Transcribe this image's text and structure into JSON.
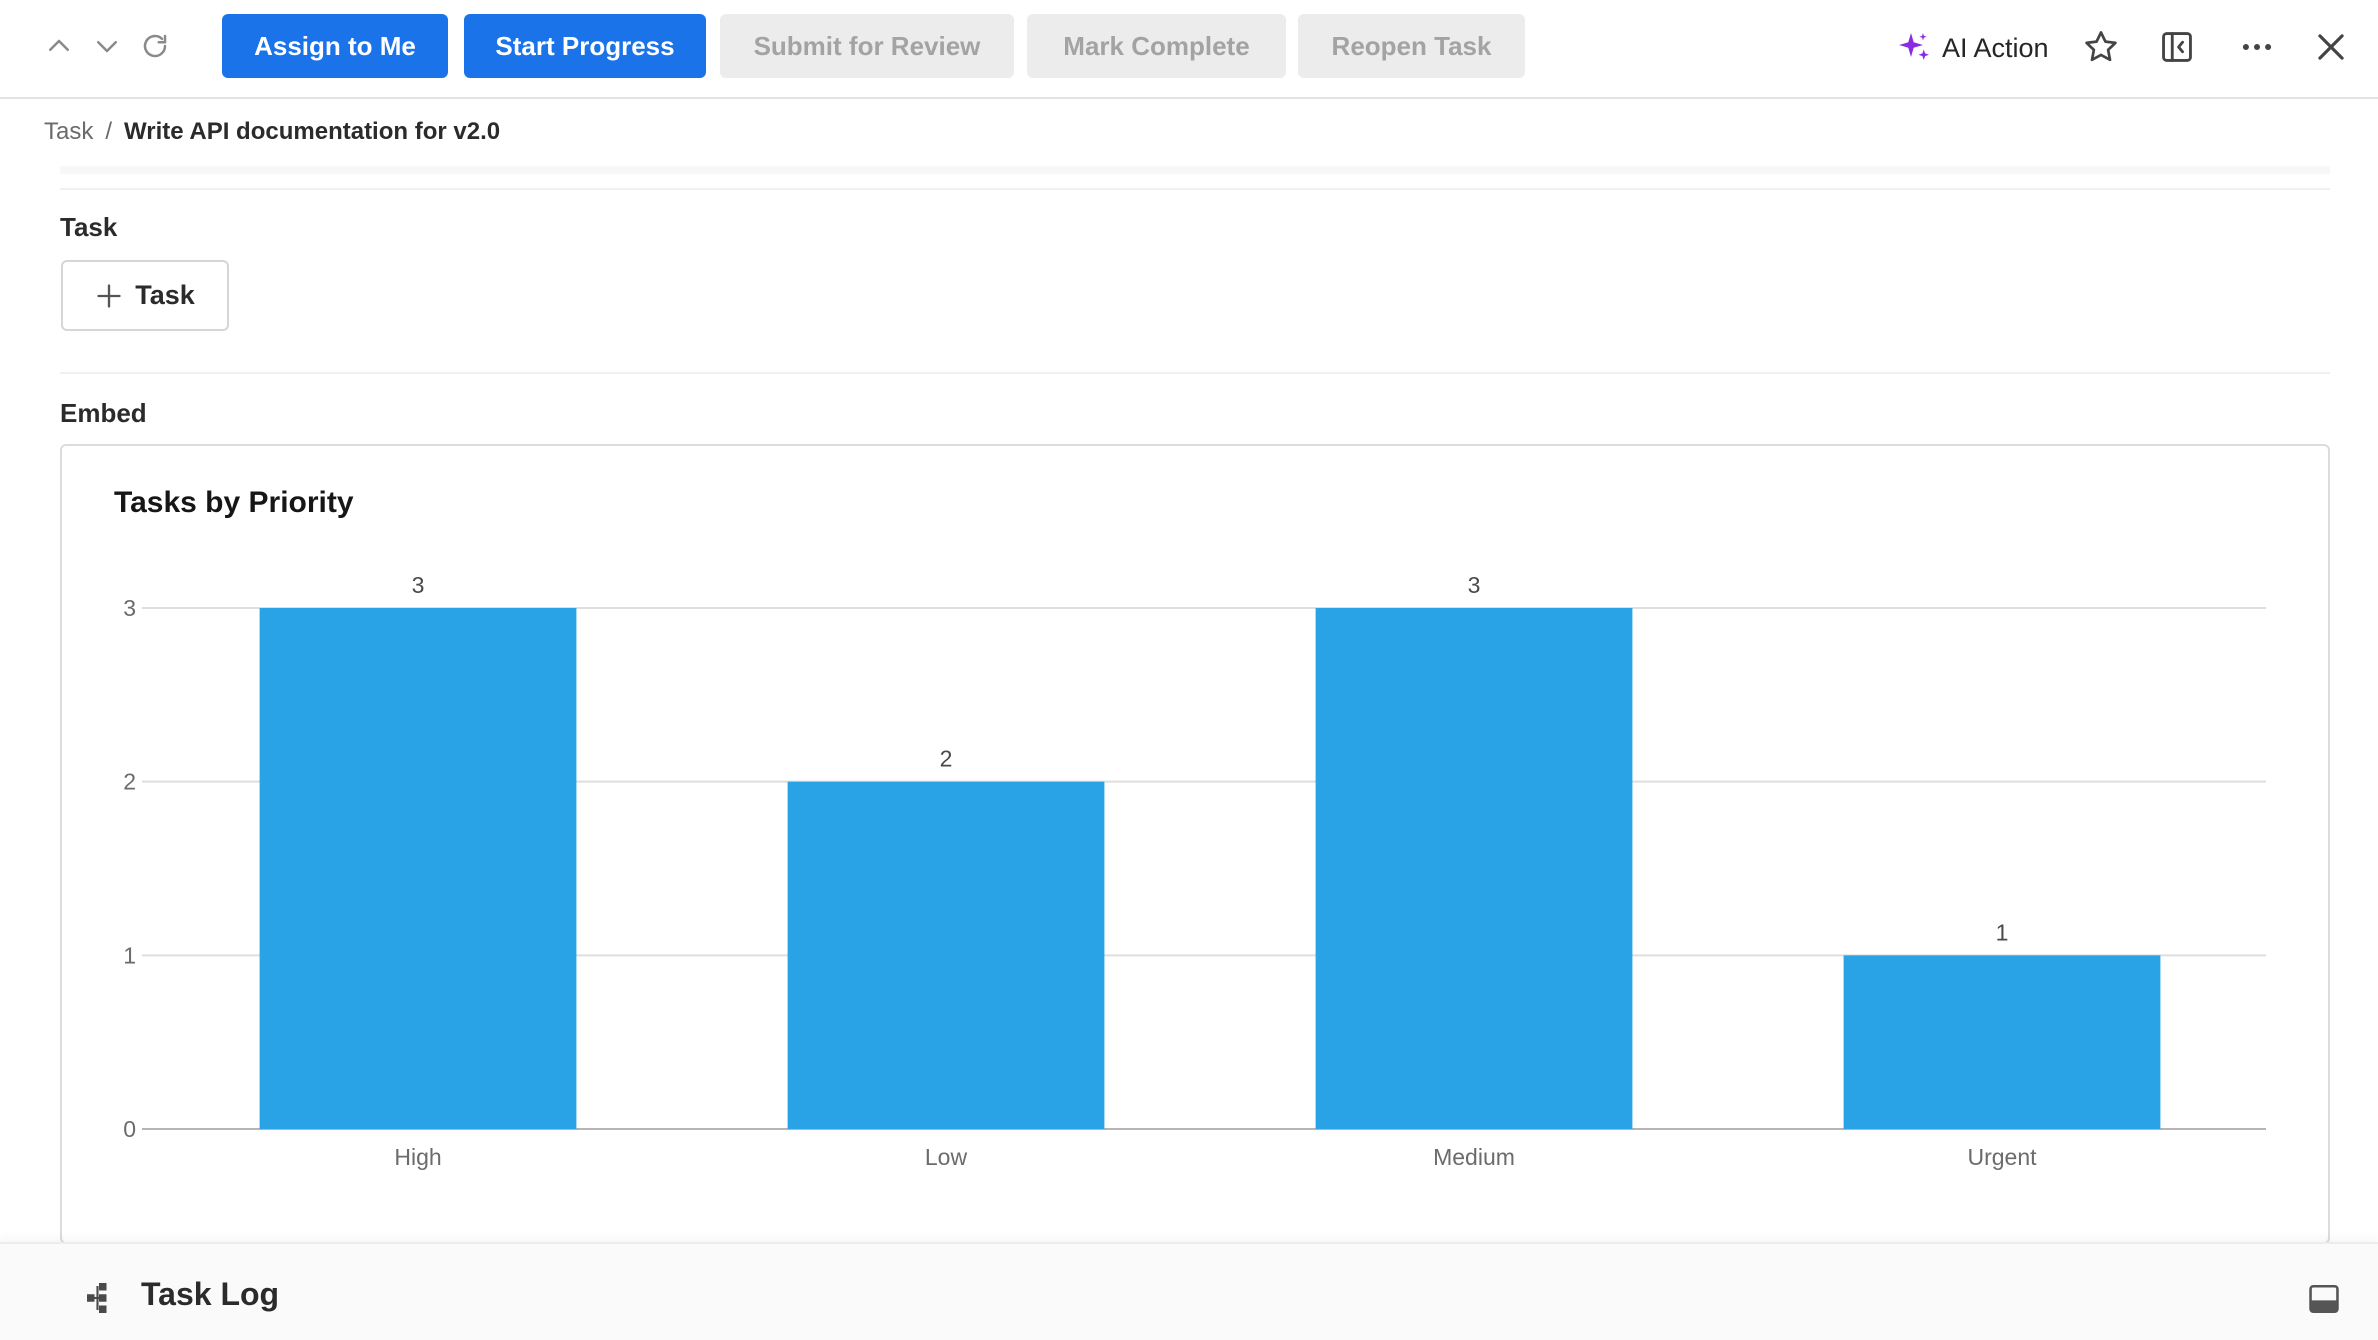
{
  "toolbar": {
    "nav_icons": [
      "chevron-up-icon",
      "chevron-down-icon",
      "refresh-icon"
    ],
    "buttons": {
      "assign_to_me": "Assign to Me",
      "start_progress": "Start Progress",
      "submit_for_review": "Submit for Review",
      "mark_complete": "Mark Complete",
      "reopen_task": "Reopen Task"
    },
    "ai_action_label": "AI Action",
    "right_icons": [
      "sparkle-icon",
      "star-icon",
      "sidebar-collapse-icon",
      "more-icon",
      "close-icon"
    ],
    "primary_color": "#1a73e8",
    "disabled_color": "#ececec",
    "ai_icon_color": "#8a2be2"
  },
  "breadcrumb": {
    "root": "Task",
    "separator": "/",
    "current": "Write API documentation for v2.0"
  },
  "sections": {
    "task_label": "Task",
    "add_task_label": "Task",
    "embed_label": "Embed"
  },
  "chart_data": {
    "type": "bar",
    "title": "Tasks by Priority",
    "categories": [
      "High",
      "Low",
      "Medium",
      "Urgent"
    ],
    "values": [
      3,
      2,
      3,
      1
    ],
    "y_ticks": [
      0,
      1,
      2,
      3
    ],
    "ylim": [
      0,
      3
    ],
    "grid": true,
    "bar_color": "#29a3e6",
    "xlabel": "",
    "ylabel": ""
  },
  "footer": {
    "task_log_label": "Task Log",
    "icons": [
      "hierarchy-icon",
      "panel-toggle-icon"
    ]
  }
}
